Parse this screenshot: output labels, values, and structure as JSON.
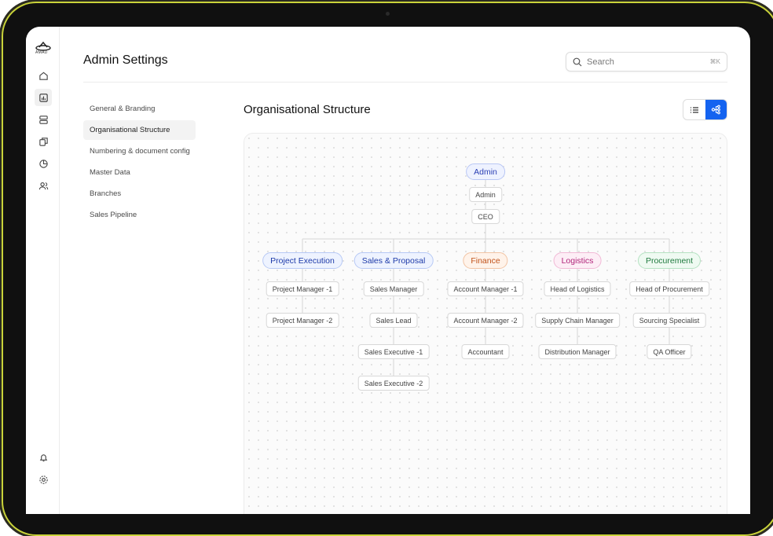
{
  "app": {
    "logo_text": "AMAD"
  },
  "header": {
    "title": "Admin Settings"
  },
  "search": {
    "placeholder": "Search",
    "shortcut": "⌘K"
  },
  "nav": {
    "items": [
      {
        "label": "General & Branding"
      },
      {
        "label": "Organisational Structure",
        "active": true
      },
      {
        "label": "Numbering & document config"
      },
      {
        "label": "Master Data"
      },
      {
        "label": "Branches"
      },
      {
        "label": "Sales Pipeline"
      }
    ]
  },
  "rail": {
    "icons": [
      "home-icon",
      "reports-icon",
      "database-icon",
      "documents-icon",
      "pie-chart-icon",
      "users-icon",
      "bell-icon",
      "settings-icon"
    ]
  },
  "section": {
    "title": "Organisational Structure",
    "view_toggle": [
      "list-view-icon",
      "tree-view-icon"
    ]
  },
  "org": {
    "root": {
      "label": "Admin"
    },
    "chain": [
      "Admin",
      "CEO"
    ],
    "departments": [
      {
        "name": "Project Execution",
        "color": "indigo",
        "roles": [
          "Project Manager -1",
          "Project Manager -2"
        ]
      },
      {
        "name": "Sales & Proposal",
        "color": "indigo",
        "roles": [
          "Sales Manager",
          "Sales Lead",
          "Sales Executive -1",
          "Sales Executive -2"
        ]
      },
      {
        "name": "Finance",
        "color": "orange",
        "roles": [
          "Account Manager -1",
          "Account Manager -2",
          "Accountant"
        ]
      },
      {
        "name": "Logistics",
        "color": "pink",
        "roles": [
          "Head of Logistics",
          "Supply Chain Manager",
          "Distribution Manager"
        ]
      },
      {
        "name": "Procurement",
        "color": "green",
        "roles": [
          "Head of Procurement",
          "Sourcing Specialist",
          "QA Officer"
        ]
      }
    ]
  },
  "colors": {
    "accent": "#1463f0",
    "bezel": "#101010",
    "bezel_edge": "#c9d33a"
  }
}
